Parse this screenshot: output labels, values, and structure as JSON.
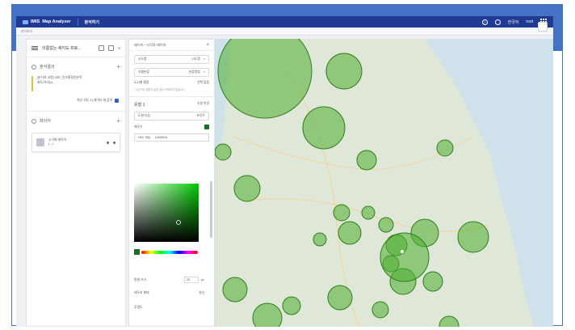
{
  "slide": {
    "title": "Map Analyzer"
  },
  "app": {
    "logo_text": "IMIS",
    "app_name": "Map Analyzer",
    "nav_item": "분석하기",
    "breadcrumb": "분석하기",
    "header_lang": "한국어",
    "header_user": "root"
  },
  "left_panel": {
    "title": "이름없는 새지도 프로...",
    "analysis_section": "분석결과",
    "analysis_text_1": "[분석지 교명] 서비_인가흥정인분학",
    "analysis_text_2": "위도/거리(x)",
    "checkbox_label": "최신 지도 시 데이터 재 검색",
    "layers_section": "레이어",
    "layer_name": "시각화 레이어",
    "layer_sub": "(...)"
  },
  "style_panel": {
    "header": "레이어 - 시각화 레이어",
    "field1_label": "시도명",
    "field1_value": "시도명",
    "field2_label": "유형분류",
    "field2_value": "분류방법",
    "row_label": "도시별 평점",
    "row_value": "선택 없음",
    "note": "* 시군구는 명칭이 같은 경우 선택되지 않습니다.",
    "section": "유형 1",
    "section_right": "유형 변경",
    "style_label": "도형 타입",
    "style_value": "포인트",
    "fill_label": "채우기",
    "hex_label": "HEX 색상",
    "hex_value": "#1E6B2A",
    "size_label": "원형 크기",
    "size_value": "20",
    "size_unit": "px",
    "border_label": "테두리 형태",
    "border_value": "실선",
    "opacity_label": "투명도"
  },
  "colors": {
    "title_bar": "#4472c4",
    "header": "#1f3a93",
    "circle_fill": "#4caf30",
    "circle_stroke": "#2e7d1e"
  }
}
